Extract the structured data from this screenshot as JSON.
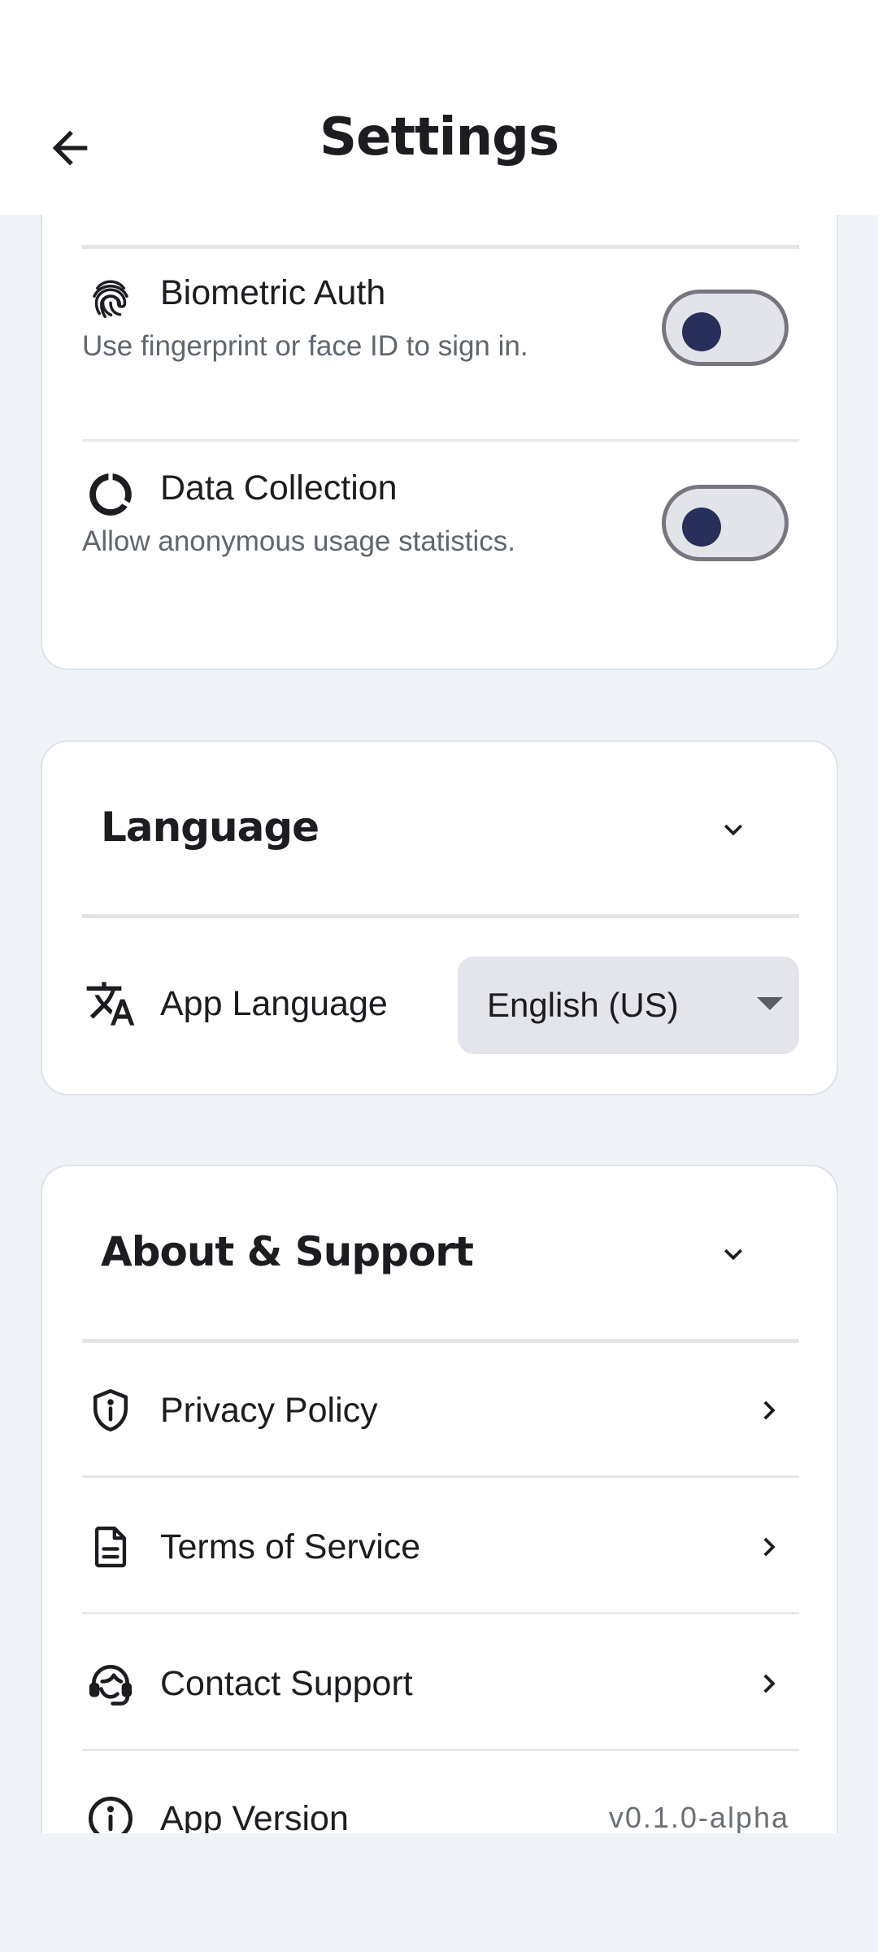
{
  "header": {
    "title": "Settings"
  },
  "security": {
    "items": [
      {
        "label": "Biometric Auth",
        "description": "Use fingerprint or face ID to sign in.",
        "icon": "fingerprint-icon",
        "enabled": false
      },
      {
        "label": "Data Collection",
        "description": "Allow anonymous usage statistics.",
        "icon": "data-usage-icon",
        "enabled": false
      }
    ]
  },
  "language": {
    "title": "Language",
    "app_language_label": "App Language",
    "selected": "English (US)"
  },
  "about": {
    "title": "About & Support",
    "links": [
      {
        "label": "Privacy Policy",
        "icon": "shield-info-icon"
      },
      {
        "label": "Terms of Service",
        "icon": "document-icon"
      },
      {
        "label": "Contact Support",
        "icon": "support-agent-icon"
      }
    ],
    "version_label": "App Version",
    "version_value": "v0.1.0-alpha"
  },
  "colors": {
    "background": "#eff2f7",
    "card": "#ffffff",
    "toggle_knob": "#27305a",
    "toggle_track": "#e3e4ea"
  }
}
